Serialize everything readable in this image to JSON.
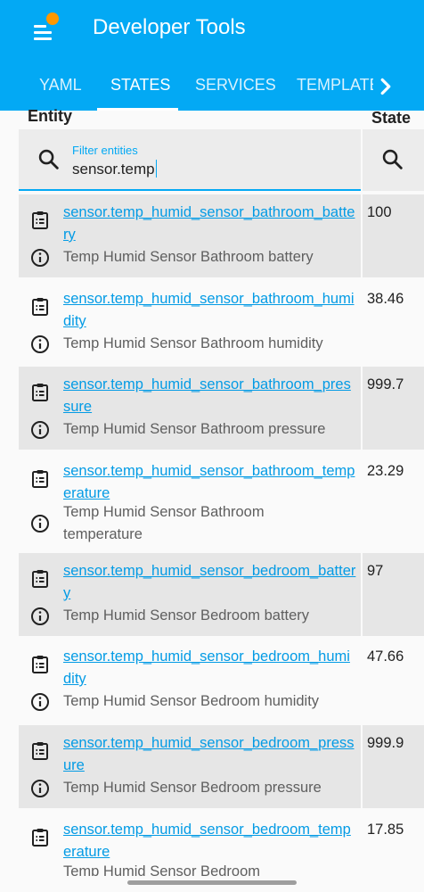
{
  "header": {
    "title": "Developer Tools",
    "tabs": [
      {
        "label": "YAML"
      },
      {
        "label": "STATES"
      },
      {
        "label": "SERVICES"
      },
      {
        "label": "TEMPLATE"
      }
    ],
    "active_tab": "STATES"
  },
  "table": {
    "column_entity": "Entity",
    "column_state": "State",
    "filter": {
      "label": "Filter entities",
      "value": "sensor.temp"
    },
    "rows": [
      {
        "entity_id": "sensor.temp_humid_sensor_bathroom_battery",
        "friendly_name": "Temp Humid Sensor Bathroom battery",
        "state": "100"
      },
      {
        "entity_id": "sensor.temp_humid_sensor_bathroom_humidity",
        "friendly_name": "Temp Humid Sensor Bathroom humidity",
        "state": "38.46"
      },
      {
        "entity_id": "sensor.temp_humid_sensor_bathroom_pressure",
        "friendly_name": "Temp Humid Sensor Bathroom pressure",
        "state": "999.7"
      },
      {
        "entity_id": "sensor.temp_humid_sensor_bathroom_temperature",
        "friendly_name": "Temp Humid Sensor Bathroom temperature",
        "state": "23.29"
      },
      {
        "entity_id": "sensor.temp_humid_sensor_bedroom_battery",
        "friendly_name": "Temp Humid Sensor Bedroom battery",
        "state": "97"
      },
      {
        "entity_id": "sensor.temp_humid_sensor_bedroom_humidity",
        "friendly_name": "Temp Humid Sensor Bedroom humidity",
        "state": "47.66"
      },
      {
        "entity_id": "sensor.temp_humid_sensor_bedroom_pressure",
        "friendly_name": "Temp Humid Sensor Bedroom pressure",
        "state": "999.9"
      },
      {
        "entity_id": "sensor.temp_humid_sensor_bedroom_temperature",
        "friendly_name": "Temp Humid Sensor Bedroom",
        "state": "17.85"
      }
    ]
  },
  "colors": {
    "header": "#03a9f4",
    "link": "#039be5",
    "badge": "#ff9800"
  },
  "icons": {
    "menu": "menu-icon",
    "search": "search-icon",
    "row_action": "clipboard-list-icon",
    "info": "information-outline-icon",
    "tab_scroll": "chevron-right-icon"
  }
}
